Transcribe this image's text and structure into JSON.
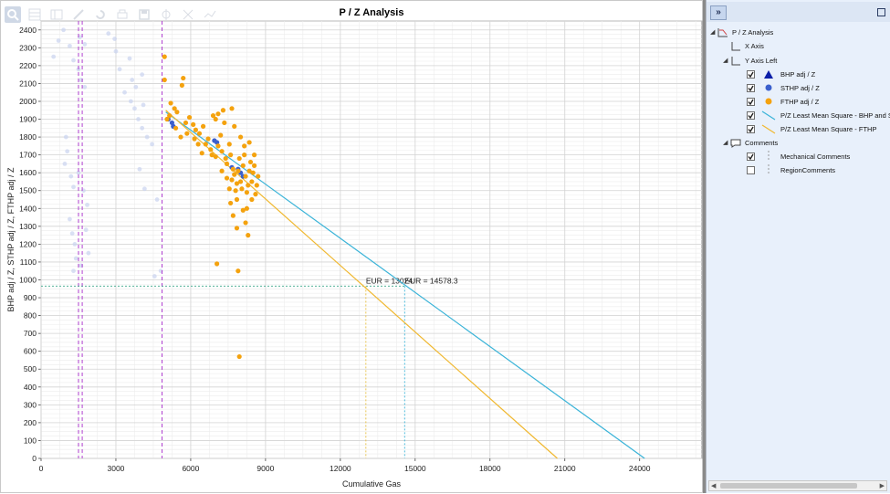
{
  "toolbar": {
    "icons": [
      "zoom-icon",
      "grid-icon",
      "table-icon",
      "expand-icon",
      "refresh-icon",
      "print-icon",
      "save-icon",
      "crosshair-icon",
      "cut-icon",
      "line-tool-icon"
    ]
  },
  "chart_data": {
    "type": "scatter",
    "title": "P / Z Analysis",
    "xlabel": "Cumulative Gas",
    "ylabel": "BHP adj / Z, STHP adj / Z, FTHP adj / Z",
    "xlim": [
      0,
      26500
    ],
    "ylim": [
      0,
      2450
    ],
    "xticks": [
      0,
      3000,
      6000,
      9000,
      12000,
      15000,
      18000,
      21000,
      24000
    ],
    "yticks": [
      0,
      100,
      200,
      300,
      400,
      500,
      600,
      700,
      800,
      900,
      1000,
      1100,
      1200,
      1300,
      1400,
      1500,
      1600,
      1700,
      1800,
      1900,
      2000,
      2100,
      2200,
      2300,
      2400
    ],
    "grid": true,
    "legend_position": "side-panel",
    "abandonment_pz": 965,
    "vertical_comment_lines": [
      {
        "x": 1500,
        "color": "#b040d0",
        "style": "dashed"
      },
      {
        "x": 1650,
        "color": "#b040d0",
        "style": "dashed"
      },
      {
        "x": 4850,
        "color": "#b040d0",
        "style": "dashed"
      }
    ],
    "series": [
      {
        "name": "STHP adj / Z",
        "color": "#3a5fcd",
        "points": [
          [
            5100,
            1900
          ],
          [
            5250,
            1880
          ],
          [
            5300,
            1860
          ],
          [
            6950,
            1780
          ],
          [
            7050,
            1770
          ],
          [
            7900,
            1620
          ],
          [
            8000,
            1600
          ],
          [
            8100,
            1580
          ],
          [
            7650,
            1630
          ]
        ]
      },
      {
        "name": "FTHP adj / Z",
        "color": "#f4a20e",
        "points": [
          [
            4950,
            2250
          ],
          [
            4950,
            2120
          ],
          [
            5700,
            2130
          ],
          [
            5200,
            1990
          ],
          [
            5350,
            1960
          ],
          [
            5450,
            1940
          ],
          [
            5150,
            1920
          ],
          [
            5050,
            1900
          ],
          [
            5400,
            1850
          ],
          [
            5600,
            1800
          ],
          [
            5800,
            1880
          ],
          [
            5950,
            1910
          ],
          [
            6100,
            1870
          ],
          [
            6200,
            1840
          ],
          [
            6350,
            1820
          ],
          [
            6500,
            1860
          ],
          [
            6700,
            1790
          ],
          [
            6600,
            1760
          ],
          [
            6800,
            1730
          ],
          [
            6850,
            1700
          ],
          [
            7000,
            1690
          ],
          [
            7100,
            1750
          ],
          [
            7200,
            1810
          ],
          [
            7250,
            1720
          ],
          [
            7400,
            1680
          ],
          [
            7450,
            1650
          ],
          [
            7550,
            1760
          ],
          [
            7600,
            1700
          ],
          [
            7650,
            1560
          ],
          [
            7700,
            1620
          ],
          [
            7750,
            1590
          ],
          [
            7800,
            1500
          ],
          [
            7850,
            1450
          ],
          [
            7850,
            1540
          ],
          [
            7900,
            1610
          ],
          [
            7950,
            1680
          ],
          [
            8000,
            1550
          ],
          [
            8050,
            1510
          ],
          [
            8100,
            1640
          ],
          [
            8150,
            1700
          ],
          [
            8200,
            1580
          ],
          [
            8250,
            1490
          ],
          [
            8300,
            1530
          ],
          [
            8350,
            1610
          ],
          [
            8400,
            1660
          ],
          [
            8450,
            1550
          ],
          [
            8500,
            1600
          ],
          [
            8550,
            1700
          ],
          [
            8600,
            1480
          ],
          [
            8650,
            1530
          ],
          [
            7600,
            1430
          ],
          [
            7700,
            1360
          ],
          [
            7450,
            1570
          ],
          [
            7550,
            1510
          ],
          [
            7350,
            1880
          ],
          [
            7100,
            1930
          ],
          [
            7300,
            1950
          ],
          [
            7650,
            1960
          ],
          [
            7000,
            1900
          ],
          [
            6900,
            1920
          ],
          [
            8000,
            1800
          ],
          [
            8150,
            1750
          ],
          [
            8350,
            1770
          ],
          [
            8100,
            1390
          ],
          [
            8200,
            1320
          ],
          [
            7850,
            1290
          ],
          [
            8300,
            1250
          ],
          [
            7900,
            1050
          ],
          [
            7050,
            1090
          ],
          [
            7950,
            570
          ],
          [
            5650,
            2090
          ],
          [
            7750,
            1860
          ],
          [
            8450,
            1450
          ],
          [
            8250,
            1400
          ],
          [
            6300,
            1760
          ],
          [
            6450,
            1710
          ],
          [
            6150,
            1790
          ],
          [
            5850,
            1820
          ],
          [
            7250,
            1610
          ],
          [
            8550,
            1640
          ],
          [
            8700,
            1580
          ]
        ]
      }
    ],
    "faded_points": [
      [
        500,
        2250
      ],
      [
        700,
        2340
      ],
      [
        900,
        2400
      ],
      [
        1150,
        2310
      ],
      [
        1300,
        2230
      ],
      [
        1500,
        2180
      ],
      [
        1600,
        2120
      ],
      [
        1750,
        2080
      ],
      [
        2700,
        2380
      ],
      [
        3000,
        2280
      ],
      [
        3150,
        2180
      ],
      [
        3350,
        2050
      ],
      [
        3600,
        2000
      ],
      [
        3750,
        1960
      ],
      [
        3900,
        1900
      ],
      [
        4050,
        1850
      ],
      [
        4100,
        1980
      ],
      [
        3800,
        2080
      ],
      [
        4250,
        1800
      ],
      [
        4450,
        1760
      ],
      [
        3950,
        1620
      ],
      [
        4150,
        1510
      ],
      [
        4050,
        2150
      ],
      [
        3650,
        2120
      ],
      [
        1000,
        1800
      ],
      [
        1050,
        1720
      ],
      [
        1200,
        1580
      ],
      [
        1300,
        1520
      ],
      [
        1500,
        1600
      ],
      [
        1700,
        1500
      ],
      [
        1850,
        1420
      ],
      [
        950,
        1650
      ],
      [
        1150,
        1340
      ],
      [
        1250,
        1260
      ],
      [
        1350,
        1200
      ],
      [
        1400,
        1120
      ],
      [
        1600,
        1080
      ],
      [
        1800,
        1280
      ],
      [
        1900,
        1150
      ],
      [
        1300,
        1050
      ],
      [
        4650,
        1450
      ],
      [
        4550,
        1020
      ],
      [
        4800,
        1050
      ],
      [
        1750,
        2320
      ],
      [
        1550,
        2360
      ],
      [
        2950,
        2350
      ],
      [
        3550,
        2240
      ]
    ],
    "trend_lines": [
      {
        "name": "P/Z Least Mean Square - BHP and STHP",
        "color": "#39b3d8",
        "from": [
          5000,
          1940
        ],
        "to": [
          24200,
          0
        ]
      },
      {
        "name": "P/Z Least Mean Square - FTHP",
        "color": "#f0b830",
        "from": [
          5000,
          1950
        ],
        "to": [
          20700,
          0
        ]
      }
    ],
    "eur_markers": [
      {
        "label": "EUR = 13024.",
        "x": 13024,
        "color": "#e8c040"
      },
      {
        "label": "EUR = 14578.3",
        "x": 14578.3,
        "color": "#39b3d8"
      }
    ]
  },
  "side_panel": {
    "tree": [
      {
        "label": "P / Z Analysis",
        "level": 0,
        "expander": "◢",
        "kind": "chart"
      },
      {
        "label": "X Axis",
        "level": 1,
        "expander": "",
        "kind": "axis"
      },
      {
        "label": "Y Axis Left",
        "level": 1,
        "expander": "◢",
        "kind": "axis"
      },
      {
        "label": "BHP adj / Z",
        "level": 2,
        "checked": true,
        "symbol": "triangle",
        "color": "#0a1ea8"
      },
      {
        "label": "STHP adj / Z",
        "level": 2,
        "checked": true,
        "symbol": "dot",
        "color": "#3a5fcd"
      },
      {
        "label": "FTHP adj / Z",
        "level": 2,
        "checked": true,
        "symbol": "dot",
        "color": "#f4a20e"
      },
      {
        "label": "P/Z Least Mean Square - BHP and STHP",
        "level": 2,
        "checked": true,
        "symbol": "line",
        "color": "#39b3d8"
      },
      {
        "label": "P/Z Least Mean Square - FTHP",
        "level": 2,
        "checked": true,
        "symbol": "line",
        "color": "#f0b830"
      },
      {
        "label": "Comments",
        "level": 1,
        "expander": "◢",
        "kind": "comment"
      },
      {
        "label": "Mechanical Comments",
        "level": 2,
        "checked": true,
        "symbol": "dashline",
        "color": "#999999"
      },
      {
        "label": "RegionComments",
        "level": 2,
        "checked": false,
        "symbol": "dashline",
        "color": "#999999"
      }
    ]
  }
}
